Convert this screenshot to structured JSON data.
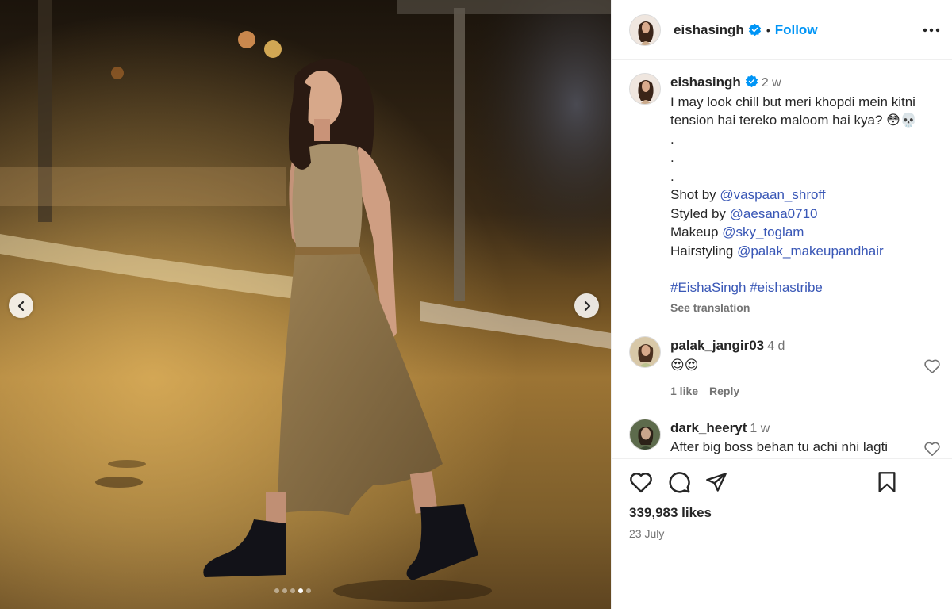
{
  "post": {
    "username": "eishasingh",
    "follow_label": "Follow",
    "separator": "•",
    "caption": {
      "time": "2 w",
      "line1": "I may look chill but meri khopdi mein kitni",
      "line2": "tension hai tereko maloom hai kya? 😳💀",
      "dot1": ".",
      "dot2": ".",
      "dot3": ".",
      "shot_prefix": "Shot by ",
      "shot_mention": "@vaspaan_shroff",
      "styled_prefix": "Styled by ",
      "styled_mention": "@aesana0710",
      "makeup_prefix": "Makeup ",
      "makeup_mention": "@sky_toglam",
      "hair_prefix": "Hairstyling ",
      "hair_mention": "@palak_makeupandhair",
      "tag1": "#EishaSingh",
      "tag2": "#eishastribe",
      "see_translation": "See translation"
    },
    "comments": [
      {
        "user": "palak_jangir03",
        "time": "4 d",
        "text": "😍😍",
        "likes": "1 like",
        "reply": "Reply"
      },
      {
        "user": "dark_heeryt",
        "time": "1 w",
        "text": "After big boss behan tu achi nhi lagti"
      }
    ],
    "likes": "339,983 likes",
    "date": "23 July",
    "carousel": {
      "count": 5,
      "active_index": 3
    },
    "colors": {
      "accent": "#0095f6",
      "mention": "#3957b6",
      "verified": "#0095f6"
    }
  }
}
